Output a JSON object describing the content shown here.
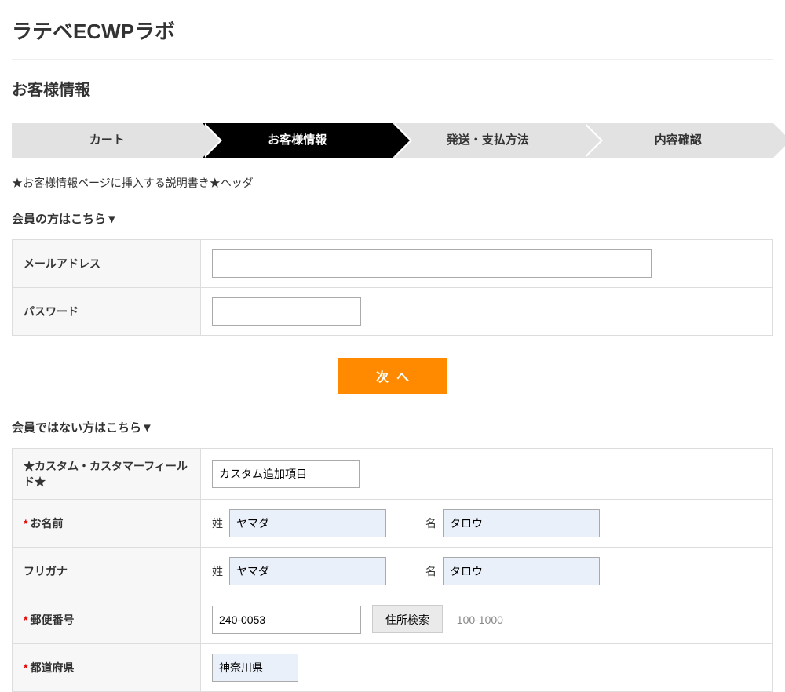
{
  "site": {
    "title": "ラテベECWPラボ"
  },
  "page": {
    "title": "お客様情報"
  },
  "progress": {
    "steps": [
      "カート",
      "お客様情報",
      "発送・支払方法",
      "内容確認"
    ],
    "active_index": 1
  },
  "header_note": "★お客様情報ページに挿入する説明書き★ヘッダ",
  "member": {
    "heading": "会員の方はこちら▼",
    "email_label": "メールアドレス",
    "password_label": "パスワード",
    "email_value": "",
    "password_value": ""
  },
  "next_button": "次へ",
  "guest": {
    "heading": "会員ではない方はこちら▼",
    "custom_field_label": "★カスタム・カスタマーフィールド★",
    "custom_field_value": "カスタム追加項目",
    "name_label": "お名前",
    "kana_label": "フリガナ",
    "sei_label": "姓",
    "mei_label": "名",
    "name_sei": "ヤマダ",
    "name_mei": "タロウ",
    "kana_sei": "ヤマダ",
    "kana_mei": "タロウ",
    "zip_label": "郵便番号",
    "zip_value": "240-0053",
    "zip_search_label": "住所検索",
    "zip_hint": "100-1000",
    "pref_label": "都道府県",
    "pref_value": "神奈川県"
  }
}
